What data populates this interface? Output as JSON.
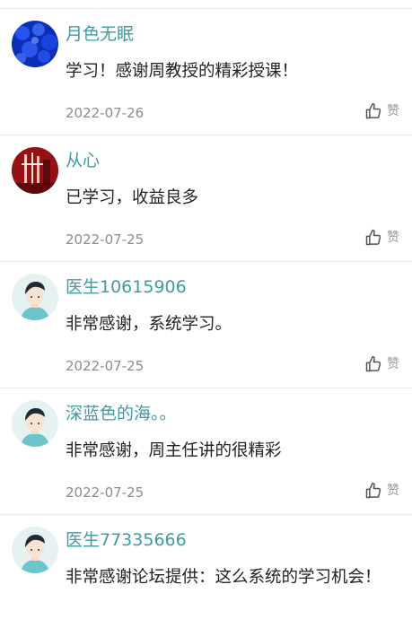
{
  "comments": [
    {
      "username": "月色无眠",
      "content": "学习！感谢周教授的精彩授课！",
      "date": "2022-07-26",
      "like_label": "赞",
      "avatar": "blue-bokeh"
    },
    {
      "username": "从心",
      "content": "已学习，收益良多",
      "date": "2022-07-25",
      "like_label": "赞",
      "avatar": "red-photo"
    },
    {
      "username": "医生10615906",
      "content": "非常感谢，系统学习。",
      "date": "2022-07-25",
      "like_label": "赞",
      "avatar": "default-cartoon"
    },
    {
      "username": "深蓝色的海。。",
      "content": "非常感谢，周主任讲的很精彩",
      "date": "2022-07-25",
      "like_label": "赞",
      "avatar": "default-cartoon"
    },
    {
      "username": "医生77335666",
      "content": "非常感谢论坛提供：这么系统的学习机会！",
      "avatar": "default-cartoon"
    }
  ],
  "icons": {
    "like": "thumbs-up-icon"
  },
  "colors": {
    "username": "#3f9aa4",
    "text": "#222222",
    "meta": "#8c8c8c",
    "divider": "#ececec"
  }
}
